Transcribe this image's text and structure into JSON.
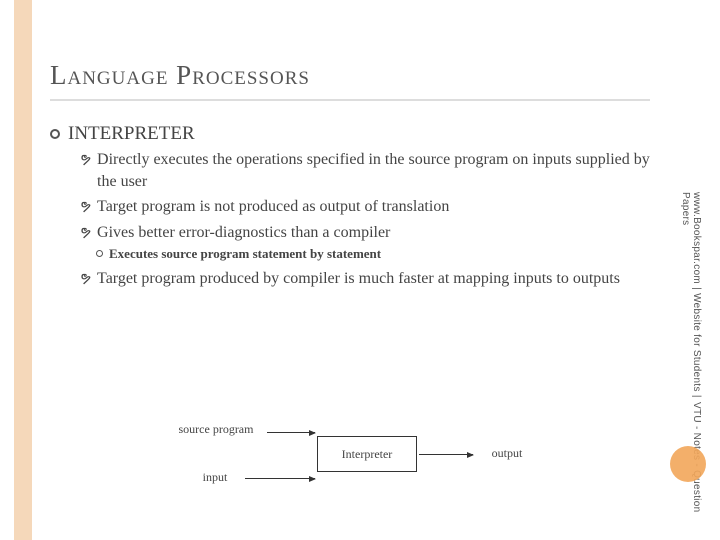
{
  "title": "Language Processors",
  "section": {
    "heading": "INTERPRETER"
  },
  "bullets": {
    "b1": "Directly executes the operations specified in the source program on inputs supplied by the user",
    "b2": "Target program is not produced as output of translation",
    "b3": "Gives better error-diagnostics than a compiler",
    "b3a": "Executes source program statement by statement",
    "b4": "Target program produced by compiler is much faster at mapping inputs to outputs"
  },
  "diagram": {
    "source": "source program",
    "input": "input",
    "box": "Interpreter",
    "output": "output"
  },
  "watermark": {
    "line1": "www.Bookspar.com | Website for Students |",
    "line2": "VTU - Notes - Question Papers"
  }
}
